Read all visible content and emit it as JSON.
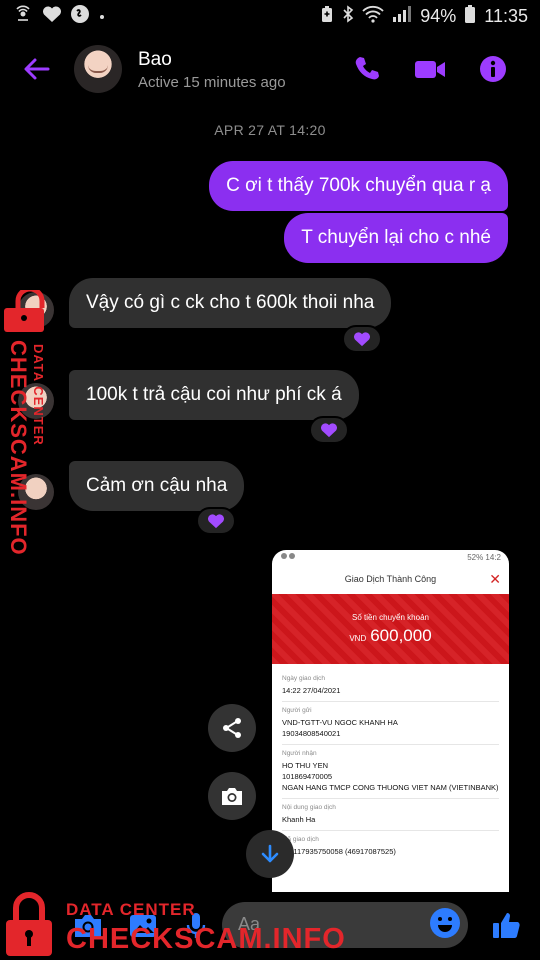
{
  "status_bar": {
    "battery": "94%",
    "time": "11:35"
  },
  "header": {
    "name": "Bao",
    "status": "Active 15 minutes ago"
  },
  "date_separator": "APR 27 AT 14:20",
  "messages": [
    {
      "side": "sent",
      "text": "C ơi t thấy 700k chuyển qua r ạ"
    },
    {
      "side": "sent",
      "text": "T chuyển lại cho c nhé"
    },
    {
      "side": "received",
      "text": "Vậy có gì c ck cho t 600k thoii nha",
      "reaction": "purple-heart"
    },
    {
      "side": "received",
      "text": "100k t trả cậu coi như phí ck á",
      "reaction": "purple-heart"
    },
    {
      "side": "received",
      "text": "Cảm ơn cậu nha",
      "reaction": "purple-heart"
    }
  ],
  "receipt": {
    "status_left": "",
    "status_right": "52% 14:2",
    "title": "Giao Dịch Thành Công",
    "amount_label": "Số tiền chuyển khoản",
    "currency": "VND",
    "amount": "600,000",
    "fields": [
      {
        "label": "Ngày giao dịch",
        "lines": [
          "14:22 27/04/2021"
        ]
      },
      {
        "label": "Người gửi",
        "lines": [
          "VND-TGTT-VU NGOC KHANH HA",
          "19034808540021"
        ]
      },
      {
        "label": "Người nhận",
        "lines": [
          "HO THU YEN",
          "101869470005",
          "NGAN HANG TMCP CONG THUONG VIET NAM (VIETINBANK)"
        ]
      },
      {
        "label": "Nội dung giao dịch",
        "lines": [
          "Khanh Ha"
        ]
      },
      {
        "label": "Mã giao dịch",
        "lines": [
          "211117935750058 (46917087525)"
        ]
      }
    ]
  },
  "composer": {
    "placeholder": "Aa"
  },
  "watermark": {
    "small_label": "DATA CENTER",
    "site": "CHECKSCAM.INFO"
  },
  "colors": {
    "accent": "#8b2ff0",
    "icon_purple": "#9d3cff",
    "received_bubble": "#303030",
    "watermark_red": "#e3262b",
    "receipt_red": "#d4171c"
  }
}
